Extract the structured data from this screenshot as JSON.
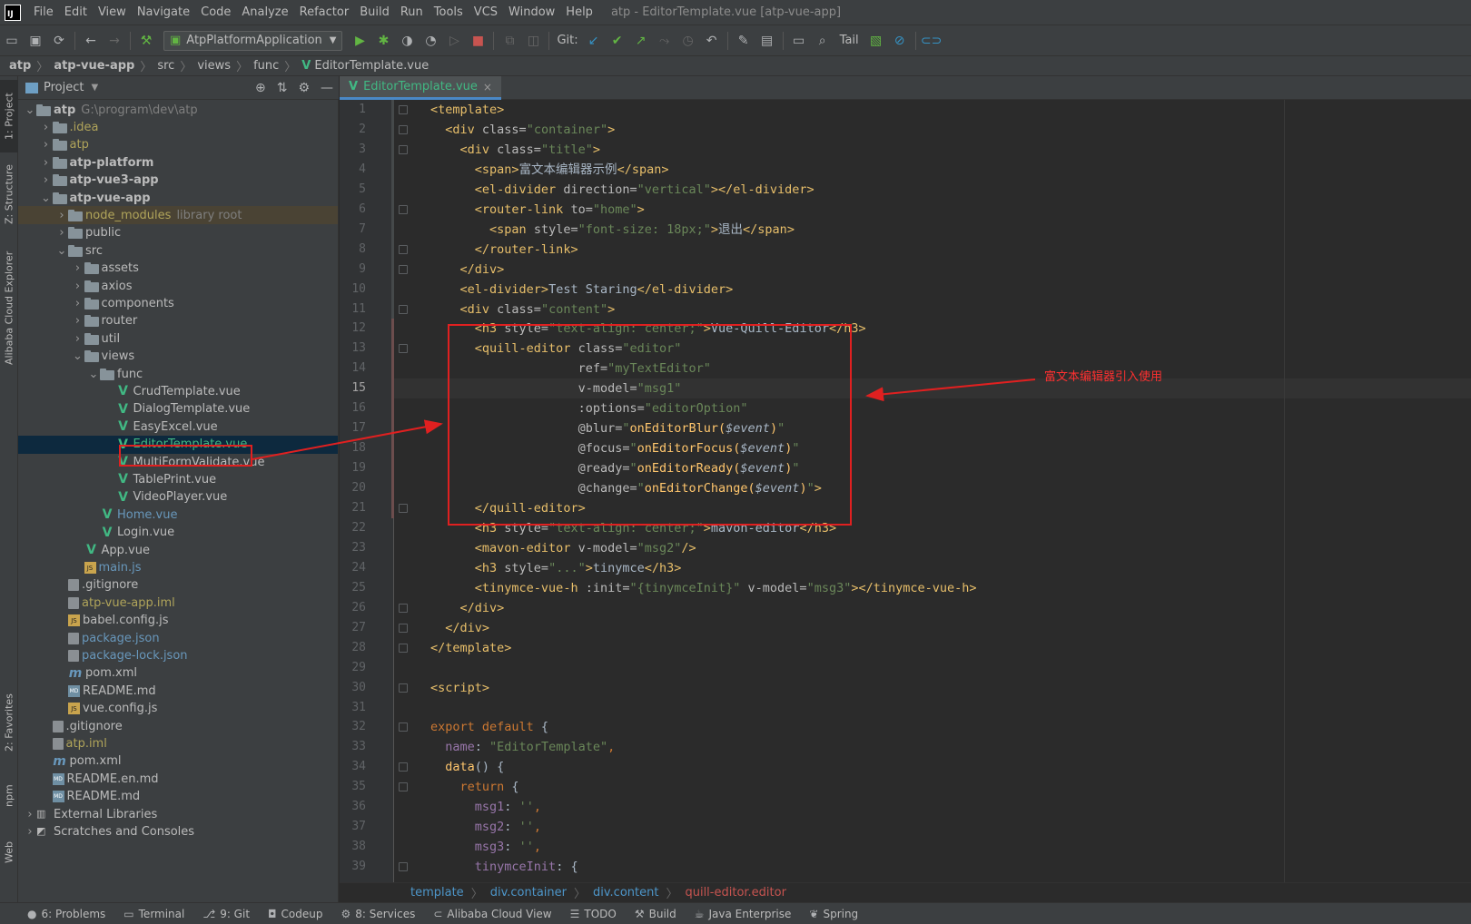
{
  "menu": {
    "items": [
      "File",
      "Edit",
      "View",
      "Navigate",
      "Code",
      "Analyze",
      "Refactor",
      "Build",
      "Run",
      "Tools",
      "VCS",
      "Window",
      "Help"
    ],
    "window_title": "atp - EditorTemplate.vue [atp-vue-app]"
  },
  "toolbar": {
    "run_config": "AtpPlatformApplication",
    "git_label": "Git:",
    "tail_label": "Tail"
  },
  "navbar": {
    "crumbs": [
      "atp",
      "atp-vue-app",
      "src",
      "views",
      "func",
      "EditorTemplate.vue"
    ]
  },
  "left_strip": {
    "tabs": [
      "1: Project",
      "Z: Structure",
      "Alibaba Cloud Explorer",
      "2: Favorites",
      "npm",
      "Web"
    ]
  },
  "project": {
    "title": "Project",
    "tree": [
      {
        "name": "atp",
        "sub": "G:\\program\\dev\\atp",
        "level": 0,
        "expanded": true,
        "icon": "folder",
        "style": "bold"
      },
      {
        "name": ".idea",
        "level": 1,
        "expanded": false,
        "icon": "folder",
        "style": "yellow"
      },
      {
        "name": "atp",
        "level": 1,
        "expanded": false,
        "icon": "folder",
        "style": "yellow"
      },
      {
        "name": "atp-platform",
        "level": 1,
        "expanded": false,
        "icon": "folder",
        "style": "bold"
      },
      {
        "name": "atp-vue3-app",
        "level": 1,
        "expanded": false,
        "icon": "folder",
        "style": "bold"
      },
      {
        "name": "atp-vue-app",
        "level": 1,
        "expanded": true,
        "icon": "folder",
        "style": "bold"
      },
      {
        "name": "node_modules",
        "sub": "library root",
        "level": 2,
        "expanded": false,
        "icon": "folder",
        "style": "yellow",
        "excluded": true
      },
      {
        "name": "public",
        "level": 2,
        "expanded": false,
        "icon": "folder"
      },
      {
        "name": "src",
        "level": 2,
        "expanded": true,
        "icon": "folder"
      },
      {
        "name": "assets",
        "level": 3,
        "expanded": false,
        "icon": "folder"
      },
      {
        "name": "axios",
        "level": 3,
        "expanded": false,
        "icon": "folder"
      },
      {
        "name": "components",
        "level": 3,
        "expanded": false,
        "icon": "folder"
      },
      {
        "name": "router",
        "level": 3,
        "expanded": false,
        "icon": "folder"
      },
      {
        "name": "util",
        "level": 3,
        "expanded": false,
        "icon": "folder"
      },
      {
        "name": "views",
        "level": 3,
        "expanded": true,
        "icon": "folder"
      },
      {
        "name": "func",
        "level": 4,
        "expanded": true,
        "icon": "folder"
      },
      {
        "name": "CrudTemplate.vue",
        "level": 5,
        "icon": "vue"
      },
      {
        "name": "DialogTemplate.vue",
        "level": 5,
        "icon": "vue"
      },
      {
        "name": "EasyExcel.vue",
        "level": 5,
        "icon": "vue"
      },
      {
        "name": "EditorTemplate.vue",
        "level": 5,
        "icon": "vue",
        "selected": true,
        "style": "green"
      },
      {
        "name": "MultiFormValidate.vue",
        "level": 5,
        "icon": "vue"
      },
      {
        "name": "TablePrint.vue",
        "level": 5,
        "icon": "vue"
      },
      {
        "name": "VideoPlayer.vue",
        "level": 5,
        "icon": "vue"
      },
      {
        "name": "Home.vue",
        "level": 4,
        "icon": "vue",
        "style": "blue"
      },
      {
        "name": "Login.vue",
        "level": 4,
        "icon": "vue"
      },
      {
        "name": "App.vue",
        "level": 3,
        "icon": "vue"
      },
      {
        "name": "main.js",
        "level": 3,
        "icon": "js",
        "style": "blue"
      },
      {
        "name": ".gitignore",
        "level": 2,
        "icon": "gen"
      },
      {
        "name": "atp-vue-app.iml",
        "level": 2,
        "icon": "gen",
        "style": "yellow"
      },
      {
        "name": "babel.config.js",
        "level": 2,
        "icon": "js"
      },
      {
        "name": "package.json",
        "level": 2,
        "icon": "gen",
        "style": "blue"
      },
      {
        "name": "package-lock.json",
        "level": 2,
        "icon": "gen",
        "style": "blue"
      },
      {
        "name": "pom.xml",
        "level": 2,
        "icon": "m"
      },
      {
        "name": "README.md",
        "level": 2,
        "icon": "md"
      },
      {
        "name": "vue.config.js",
        "level": 2,
        "icon": "js"
      },
      {
        "name": ".gitignore",
        "level": 1,
        "icon": "gen"
      },
      {
        "name": "atp.iml",
        "level": 1,
        "icon": "gen",
        "style": "yellow"
      },
      {
        "name": "pom.xml",
        "level": 1,
        "icon": "m"
      },
      {
        "name": "README.en.md",
        "level": 1,
        "icon": "md"
      },
      {
        "name": "README.md",
        "level": 1,
        "icon": "md"
      },
      {
        "name": "External Libraries",
        "level": 0,
        "expanded": false,
        "icon": "lib"
      },
      {
        "name": "Scratches and Consoles",
        "level": 0,
        "expanded": false,
        "icon": "scratch"
      }
    ]
  },
  "editor": {
    "tab_label": "EditorTemplate.vue",
    "current_line": 15,
    "lines": [
      [
        [
          "tg",
          "<template>"
        ]
      ],
      [
        [
          "tx",
          "  "
        ],
        [
          "tg",
          "<div "
        ],
        [
          "at",
          "class="
        ],
        [
          "av",
          "\"container\""
        ],
        [
          "tg",
          ">"
        ]
      ],
      [
        [
          "tx",
          "    "
        ],
        [
          "tg",
          "<div "
        ],
        [
          "at",
          "class="
        ],
        [
          "av",
          "\"title\""
        ],
        [
          "tg",
          ">"
        ]
      ],
      [
        [
          "tx",
          "      "
        ],
        [
          "tg",
          "<span>"
        ],
        [
          "tx",
          "富文本编辑器示例"
        ],
        [
          "tg",
          "</span>"
        ]
      ],
      [
        [
          "tx",
          "      "
        ],
        [
          "tg",
          "<el-divider "
        ],
        [
          "at",
          "direction="
        ],
        [
          "av",
          "\"vertical\""
        ],
        [
          "tg",
          "></el-divider>"
        ]
      ],
      [
        [
          "tx",
          "      "
        ],
        [
          "tg",
          "<router-link "
        ],
        [
          "at",
          "to="
        ],
        [
          "av",
          "\"home\""
        ],
        [
          "tg",
          ">"
        ]
      ],
      [
        [
          "tx",
          "        "
        ],
        [
          "tg",
          "<span "
        ],
        [
          "at",
          "style="
        ],
        [
          "av",
          "\"font-size: 18px;\""
        ],
        [
          "tg",
          ">"
        ],
        [
          "tx",
          "退出"
        ],
        [
          "tg",
          "</span>"
        ]
      ],
      [
        [
          "tx",
          "      "
        ],
        [
          "tg",
          "</router-link>"
        ]
      ],
      [
        [
          "tx",
          "    "
        ],
        [
          "tg",
          "</div>"
        ]
      ],
      [
        [
          "tx",
          "    "
        ],
        [
          "tg",
          "<el-divider>"
        ],
        [
          "tx",
          "Test Staring"
        ],
        [
          "tg",
          "</el-divider>"
        ]
      ],
      [
        [
          "tx",
          "    "
        ],
        [
          "tg",
          "<div "
        ],
        [
          "at",
          "class="
        ],
        [
          "av",
          "\"content\""
        ],
        [
          "tg",
          ">"
        ]
      ],
      [
        [
          "tx",
          "      "
        ],
        [
          "tg",
          "<h3 "
        ],
        [
          "at",
          "style="
        ],
        [
          "av",
          "\"text-align: center;\""
        ],
        [
          "tg",
          ">"
        ],
        [
          "tx",
          "Vue-Quill-Editor"
        ],
        [
          "tg",
          "</h3>"
        ]
      ],
      [
        [
          "tx",
          "      "
        ],
        [
          "tg",
          "<quill-editor "
        ],
        [
          "at",
          "class="
        ],
        [
          "av",
          "\"editor\""
        ]
      ],
      [
        [
          "tx",
          "                    "
        ],
        [
          "at",
          "ref="
        ],
        [
          "av",
          "\"myTextEditor\""
        ]
      ],
      [
        [
          "tx",
          "                    "
        ],
        [
          "at",
          "v-model="
        ],
        [
          "av",
          "\"msg1\""
        ]
      ],
      [
        [
          "tx",
          "                    "
        ],
        [
          "at",
          ":options="
        ],
        [
          "av",
          "\"editorOption\""
        ]
      ],
      [
        [
          "tx",
          "                    "
        ],
        [
          "at",
          "@blur="
        ],
        [
          "av",
          "\""
        ],
        [
          "fn",
          "onEditorBlur("
        ],
        [
          "ev",
          "$event"
        ],
        [
          "fn",
          ")"
        ],
        [
          "av",
          "\""
        ]
      ],
      [
        [
          "tx",
          "                    "
        ],
        [
          "at",
          "@focus="
        ],
        [
          "av",
          "\""
        ],
        [
          "fn",
          "onEditorFocus("
        ],
        [
          "ev",
          "$event"
        ],
        [
          "fn",
          ")"
        ],
        [
          "av",
          "\""
        ]
      ],
      [
        [
          "tx",
          "                    "
        ],
        [
          "at",
          "@ready="
        ],
        [
          "av",
          "\""
        ],
        [
          "fn",
          "onEditorReady("
        ],
        [
          "ev",
          "$event"
        ],
        [
          "fn",
          ")"
        ],
        [
          "av",
          "\""
        ]
      ],
      [
        [
          "tx",
          "                    "
        ],
        [
          "at",
          "@change="
        ],
        [
          "av",
          "\""
        ],
        [
          "fn",
          "onEditorChange("
        ],
        [
          "ev",
          "$event"
        ],
        [
          "fn",
          ")"
        ],
        [
          "av",
          "\""
        ],
        [
          "tg",
          ">"
        ]
      ],
      [
        [
          "tx",
          "      "
        ],
        [
          "tg",
          "</quill-editor>"
        ]
      ],
      [
        [
          "tx",
          "      "
        ],
        [
          "tg",
          "<h3 "
        ],
        [
          "at",
          "style="
        ],
        [
          "av",
          "\"text-align: center;\""
        ],
        [
          "tg",
          ">"
        ],
        [
          "tx",
          "mavon-editor"
        ],
        [
          "tg",
          "</h3>"
        ]
      ],
      [
        [
          "tx",
          "      "
        ],
        [
          "tg",
          "<mavon-editor "
        ],
        [
          "at",
          "v-model="
        ],
        [
          "av",
          "\"msg2\""
        ],
        [
          "tg",
          "/>"
        ]
      ],
      [
        [
          "tx",
          "      "
        ],
        [
          "tg",
          "<h3 "
        ],
        [
          "at",
          "style="
        ],
        [
          "av",
          "\"...\""
        ],
        [
          "tg",
          ">"
        ],
        [
          "tx",
          "tinymce"
        ],
        [
          "tg",
          "</h3>"
        ]
      ],
      [
        [
          "tx",
          "      "
        ],
        [
          "tg",
          "<tinymce-vue-h "
        ],
        [
          "at",
          ":init="
        ],
        [
          "av",
          "\"{tinymceInit}\" "
        ],
        [
          "at",
          "v-model="
        ],
        [
          "av",
          "\"msg3\""
        ],
        [
          "tg",
          "></tinymce-vue-h>"
        ]
      ],
      [
        [
          "tx",
          "    "
        ],
        [
          "tg",
          "</div>"
        ]
      ],
      [
        [
          "tx",
          "  "
        ],
        [
          "tg",
          "</div>"
        ]
      ],
      [
        [
          "tg",
          "</template>"
        ]
      ],
      [
        [
          "tx",
          ""
        ]
      ],
      [
        [
          "tg",
          "<script>"
        ]
      ],
      [
        [
          "tx",
          ""
        ]
      ],
      [
        [
          "kw",
          "export default "
        ],
        [
          "tx",
          "{"
        ]
      ],
      [
        [
          "tx",
          "  "
        ],
        [
          "prop",
          "name"
        ],
        [
          "tx",
          ": "
        ],
        [
          "str",
          "\"EditorTemplate\""
        ],
        [
          "pu",
          ","
        ]
      ],
      [
        [
          "tx",
          "  "
        ],
        [
          "fn",
          "data"
        ],
        [
          "tx",
          "() {"
        ]
      ],
      [
        [
          "tx",
          "    "
        ],
        [
          "kw",
          "return "
        ],
        [
          "tx",
          "{"
        ]
      ],
      [
        [
          "tx",
          "      "
        ],
        [
          "prop",
          "msg1"
        ],
        [
          "tx",
          ": "
        ],
        [
          "str",
          "''"
        ],
        [
          "pu",
          ","
        ]
      ],
      [
        [
          "tx",
          "      "
        ],
        [
          "prop",
          "msg2"
        ],
        [
          "tx",
          ": "
        ],
        [
          "str",
          "''"
        ],
        [
          "pu",
          ","
        ]
      ],
      [
        [
          "tx",
          "      "
        ],
        [
          "prop",
          "msg3"
        ],
        [
          "tx",
          ": "
        ],
        [
          "str",
          "''"
        ],
        [
          "pu",
          ","
        ]
      ],
      [
        [
          "tx",
          "      "
        ],
        [
          "prop",
          "tinymceInit"
        ],
        [
          "tx",
          ": {"
        ]
      ]
    ]
  },
  "annotation": {
    "text": "富文本编辑器引入使用"
  },
  "code_breadcrumb": [
    "template",
    "div.container",
    "div.content",
    "quill-editor.editor"
  ],
  "statusbar": {
    "tabs": [
      {
        "label": "6: Problems",
        "icon": "problems-icon"
      },
      {
        "label": "Terminal",
        "icon": "terminal-icon"
      },
      {
        "label": "9: Git",
        "icon": "git-icon"
      },
      {
        "label": "Codeup",
        "icon": "codeup-icon"
      },
      {
        "label": "8: Services",
        "icon": "services-icon"
      },
      {
        "label": "Alibaba Cloud View",
        "icon": "cloud-icon"
      },
      {
        "label": "TODO",
        "icon": "todo-icon"
      },
      {
        "label": "Build",
        "icon": "build-icon"
      },
      {
        "label": "Java Enterprise",
        "icon": "java-icon"
      },
      {
        "label": "Spring",
        "icon": "spring-icon"
      }
    ]
  },
  "colors": {
    "accent": "#4a88c7",
    "vue_green": "#41b883",
    "annotation_red": "#e02020"
  }
}
